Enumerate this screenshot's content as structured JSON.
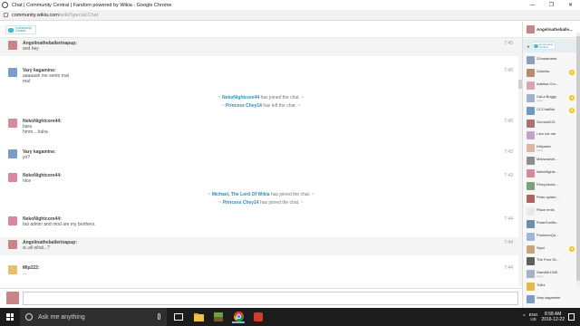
{
  "window": {
    "title": "Chat | Community Central | Fandom powered by Wikia - Google Chrome",
    "controls": {
      "minimize": "—",
      "restore": "❐",
      "close": "✕"
    }
  },
  "address": {
    "host": "community.wikia.com",
    "path": "/wiki/Special:Chat"
  },
  "wiki": {
    "logo_line1": "Community",
    "logo_line2": "Central"
  },
  "messages": [
    {
      "name": "Angelinatheballerinapup:",
      "lines": [
        "and hey"
      ],
      "time": "7:45",
      "alt": true,
      "avatar_color": "#c98585"
    },
    {
      "name": "Vary kagamine:",
      "lines": [
        "aaaaaah me sento mal",
        "mal"
      ],
      "time": "7:45",
      "alt": false,
      "avatar_color": "#7a9cc9"
    },
    {
      "name": "NekoNightcore44:",
      "lines": [
        "bara",
        "hmm....haha"
      ],
      "time": "7:45",
      "alt": false,
      "avatar_color": "#d98a9a"
    },
    {
      "name": "Vary kagamine:",
      "lines": [
        "yo?"
      ],
      "time": "7:43",
      "alt": false,
      "avatar_color": "#7a9cc9"
    },
    {
      "name": "NekoNightcore44:",
      "lines": [
        "nice"
      ],
      "time": "7:43",
      "alt": false,
      "avatar_color": "#d98a9a"
    },
    {
      "name": "NekoNightcore44:",
      "lines": [
        "but admin and mod are my brothers."
      ],
      "time": "7:44",
      "alt": false,
      "avatar_color": "#d98a9a"
    },
    {
      "name": "Angelinatheballerinapup:",
      "lines": [
        "w..all what...?"
      ],
      "time": "7:44",
      "alt": true,
      "avatar_color": "#c98585"
    },
    {
      "name": "Mlp222:",
      "lines": [
        "..."
      ],
      "time": "7:44",
      "alt": false,
      "avatar_color": "#e8c06a"
    }
  ],
  "alerts": [
    {
      "who": "NekoNightcore44",
      "text": "has joined the chat."
    },
    {
      "who": "Princess Chey14",
      "text": "has left the chat."
    },
    {
      "who": "Michael, The Lord Of Wikia",
      "text": "has joined the chat."
    },
    {
      "who": "Princess Chey14",
      "text": "has joined the chat."
    }
  ],
  "me": {
    "name": "Angelinatheballe...",
    "avatar_color": "#c98585"
  },
  "users": [
    {
      "name": "22mdamand",
      "status": "",
      "badge": false,
      "color": "#8aa0b8"
    },
    {
      "name": "2Admiw",
      "status": "",
      "badge": true,
      "color": "#b98b6a"
    },
    {
      "name": "Adelina Cro...",
      "status": "",
      "badge": false,
      "color": "#d9a3b0"
    },
    {
      "name": "Cat.a.Buggy",
      "status": "Away",
      "badge": true,
      "color": "#9fb5c7"
    },
    {
      "name": "CCChatBot",
      "status": "",
      "badge": true,
      "color": "#6f9ac2"
    },
    {
      "name": "Gumont221",
      "status": "",
      "badge": false,
      "color": "#a87373"
    },
    {
      "name": "I am not me",
      "status": "",
      "badge": false,
      "color": "#c4a2c9"
    },
    {
      "name": "Kittyrater",
      "status": "Away",
      "badge": false,
      "color": "#e0b3a3"
    },
    {
      "name": "Marluxandr...",
      "status": "",
      "badge": false,
      "color": "#8d8d8d"
    },
    {
      "name": "NekoNightc...",
      "status": "",
      "badge": false,
      "color": "#d98a9a"
    },
    {
      "name": "PercyJacks...",
      "status": "",
      "badge": false,
      "color": "#7ba47b"
    },
    {
      "name": "Peter spider...",
      "status": "",
      "badge": false,
      "color": "#b76060"
    },
    {
      "name": "Place emik",
      "status": "",
      "badge": false,
      "color": "#e8e8e8"
    },
    {
      "name": "PolarGorillin...",
      "status": "",
      "badge": false,
      "color": "#6c8fb0"
    },
    {
      "name": "PusheenQu...",
      "status": "",
      "badge": false,
      "color": "#9db6d9"
    },
    {
      "name": "Siyal",
      "status": "",
      "badge": true,
      "color": "#c9a37a"
    },
    {
      "name": "The Pure Dr...",
      "status": "",
      "badge": false,
      "color": "#5f5f5f"
    },
    {
      "name": "Starville1345",
      "status": "Away",
      "badge": false,
      "color": "#a3b4c7"
    },
    {
      "name": "Tulini",
      "status": "",
      "badge": false,
      "color": "#e7b84a"
    },
    {
      "name": "Vary kagamine",
      "status": "",
      "badge": false,
      "color": "#7a9cc9"
    }
  ],
  "taskbar": {
    "search_placeholder": "Ask me anything",
    "lang_top": "ENG",
    "lang_bottom": "US",
    "time": "8:58 AM",
    "date": "2016-12-22"
  }
}
